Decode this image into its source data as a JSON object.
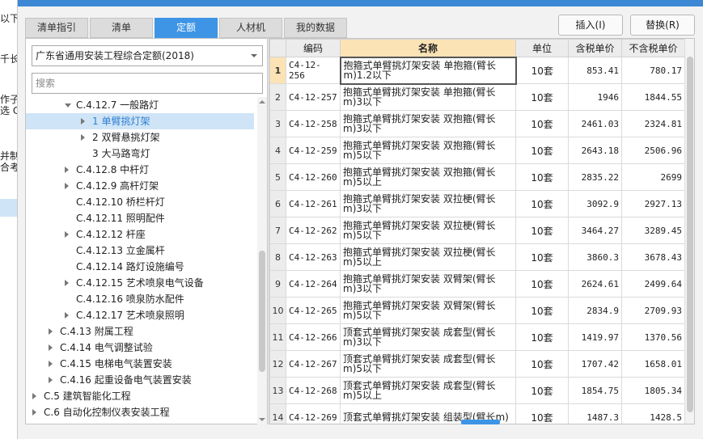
{
  "background_window": {
    "fragments": [
      "以下",
      "千长m",
      "作子",
      "选 C",
      "并制",
      "合考"
    ]
  },
  "tabs": [
    {
      "label": "清单指引",
      "active": false
    },
    {
      "label": "清单",
      "active": false
    },
    {
      "label": "定额",
      "active": true
    },
    {
      "label": "人材机",
      "active": false
    },
    {
      "label": "我的数据",
      "active": false
    }
  ],
  "buttons": {
    "insert": "插入(I)",
    "replace": "替换(R)"
  },
  "library": {
    "selected": "广东省通用安装工程综合定额(2018)"
  },
  "search": {
    "placeholder": "搜索"
  },
  "tree": [
    {
      "label": "C.4.12.7 一般路灯",
      "level": 2,
      "caret": "down"
    },
    {
      "label": "1 单臂挑灯架",
      "level": 3,
      "caret": "right",
      "selected": true
    },
    {
      "label": "2 双臂悬挑灯架",
      "level": 3,
      "caret": "right"
    },
    {
      "label": "3 大马路弯灯",
      "level": 3,
      "caret": ""
    },
    {
      "label": "C.4.12.8 中杆灯",
      "level": 2,
      "caret": "right"
    },
    {
      "label": "C.4.12.9 高杆灯架",
      "level": 2,
      "caret": "right"
    },
    {
      "label": "C.4.12.10 桥栏杆灯",
      "level": 2,
      "caret": ""
    },
    {
      "label": "C.4.12.11 照明配件",
      "level": 2,
      "caret": ""
    },
    {
      "label": "C.4.12.12 杆座",
      "level": 2,
      "caret": "right"
    },
    {
      "label": "C.4.12.13 立金属杆",
      "level": 2,
      "caret": ""
    },
    {
      "label": "C.4.12.14 路灯设施编号",
      "level": 2,
      "caret": ""
    },
    {
      "label": "C.4.12.15 艺术喷泉电气设备",
      "level": 2,
      "caret": "right"
    },
    {
      "label": "C.4.12.16 喷泉防水配件",
      "level": 2,
      "caret": ""
    },
    {
      "label": "C.4.12.17 艺术喷泉照明",
      "level": 2,
      "caret": "right"
    },
    {
      "label": "C.4.13 附属工程",
      "level": 1,
      "caret": "right"
    },
    {
      "label": "C.4.14 电气调整试验",
      "level": 1,
      "caret": "right"
    },
    {
      "label": "C.4.15 电梯电气装置安装",
      "level": 1,
      "caret": "right"
    },
    {
      "label": "C.4.16 起重设备电气装置安装",
      "level": 1,
      "caret": "right"
    },
    {
      "label": "C.5 建筑智能化工程",
      "level": 0,
      "caret": "right"
    },
    {
      "label": "C.6 自动化控制仪表安装工程",
      "level": 0,
      "caret": "right"
    }
  ],
  "table": {
    "headers": [
      "",
      "编码",
      "名称",
      "单位",
      "含税单价",
      "不含税单价"
    ],
    "rows": [
      {
        "idx": "1",
        "code": "C4-12-256",
        "name": "抱箍式单臂挑灯架安装 单抱箍(臂长m)1.2以下",
        "unit": "10套",
        "tax": "853.41",
        "notax": "780.17"
      },
      {
        "idx": "2",
        "code": "C4-12-257",
        "name": "抱箍式单臂挑灯架安装 单抱箍(臂长m)3以下",
        "unit": "10套",
        "tax": "1946",
        "notax": "1844.55"
      },
      {
        "idx": "3",
        "code": "C4-12-258",
        "name": "抱箍式单臂挑灯架安装 双抱箍(臂长m)3以下",
        "unit": "10套",
        "tax": "2461.03",
        "notax": "2324.81"
      },
      {
        "idx": "4",
        "code": "C4-12-259",
        "name": "抱箍式单臂挑灯架安装 双抱箍(臂长m)5以下",
        "unit": "10套",
        "tax": "2643.18",
        "notax": "2506.96"
      },
      {
        "idx": "5",
        "code": "C4-12-260",
        "name": "抱箍式单臂挑灯架安装 双抱箍(臂长m)5以上",
        "unit": "10套",
        "tax": "2835.22",
        "notax": "2699"
      },
      {
        "idx": "6",
        "code": "C4-12-261",
        "name": "抱箍式单臂挑灯架安装 双拉梗(臂长m)3以下",
        "unit": "10套",
        "tax": "3092.9",
        "notax": "2927.13"
      },
      {
        "idx": "7",
        "code": "C4-12-262",
        "name": "抱箍式单臂挑灯架安装 双拉梗(臂长m)5以下",
        "unit": "10套",
        "tax": "3464.27",
        "notax": "3289.45"
      },
      {
        "idx": "8",
        "code": "C4-12-263",
        "name": "抱箍式单臂挑灯架安装 双拉梗(臂长m)5以上",
        "unit": "10套",
        "tax": "3860.3",
        "notax": "3678.43"
      },
      {
        "idx": "9",
        "code": "C4-12-264",
        "name": "抱箍式单臂挑灯架安装 双臂架(臂长m)3以下",
        "unit": "10套",
        "tax": "2624.61",
        "notax": "2499.64"
      },
      {
        "idx": "10",
        "code": "C4-12-265",
        "name": "抱箍式单臂挑灯架安装 双臂架(臂长m)5以下",
        "unit": "10套",
        "tax": "2834.9",
        "notax": "2709.93"
      },
      {
        "idx": "11",
        "code": "C4-12-266",
        "name": "顶套式单臂挑灯架安装 成套型(臂长m)3以下",
        "unit": "10套",
        "tax": "1419.97",
        "notax": "1370.56"
      },
      {
        "idx": "12",
        "code": "C4-12-267",
        "name": "顶套式单臂挑灯架安装 成套型(臂长m)5以下",
        "unit": "10套",
        "tax": "1707.42",
        "notax": "1658.01"
      },
      {
        "idx": "13",
        "code": "C4-12-268",
        "name": "顶套式单臂挑灯架安装 成套型(臂长m)5以上",
        "unit": "10套",
        "tax": "1854.75",
        "notax": "1805.34"
      },
      {
        "idx": "14",
        "code": "C4-12-269",
        "name": "顶套式单臂挑灯架安装 组装型(臂长m)",
        "unit": "10套",
        "tax": "1487.3",
        "notax": "1428.5"
      }
    ]
  }
}
